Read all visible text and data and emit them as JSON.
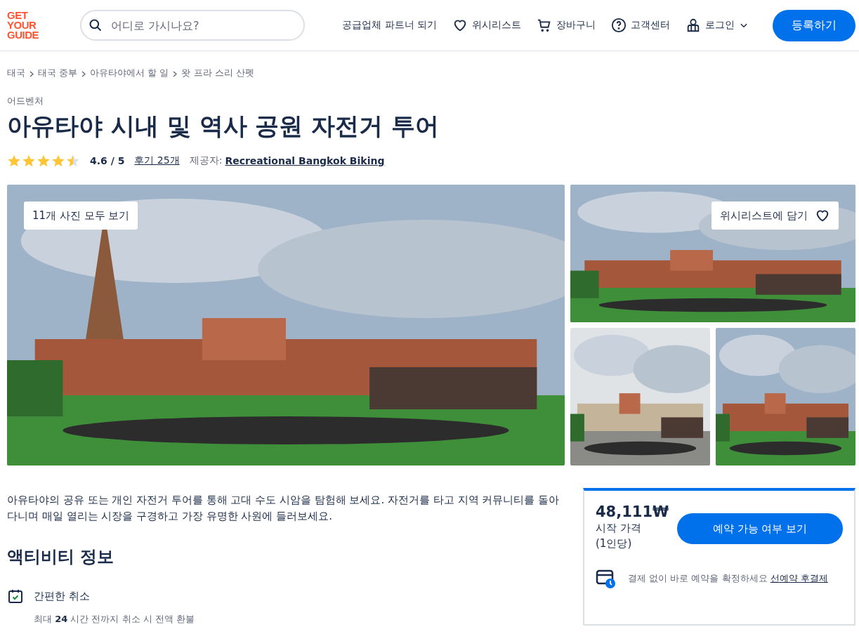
{
  "header": {
    "logo": [
      "GET",
      "YOUR",
      "GUIDE"
    ],
    "search": {
      "placeholder": "어디로 가시나요?"
    },
    "nav": [
      {
        "kind": "text",
        "label": "공급업체 파트너 되기"
      },
      {
        "kind": "heart",
        "label": "위시리스트"
      },
      {
        "kind": "cart",
        "label": "장바구니"
      },
      {
        "kind": "help",
        "label": "고객센터"
      },
      {
        "kind": "user",
        "label": "로그인"
      }
    ],
    "signup": "등록하기"
  },
  "breadcrumbs": [
    "태국",
    "태국 중부",
    "아유타야에서 할 일",
    "왓 프라 스리 산펫"
  ],
  "category": "어드벤처",
  "title": "아유타야 시내 및 역사 공원 자전거 투어",
  "rating": {
    "stars": 4.5,
    "score": "4.6 / 5",
    "reviews": "후기 25개",
    "provider_label": "제공자:",
    "provider": "Recreational Bangkok Biking"
  },
  "gallery": {
    "all_photos": "11개 사진 모두 보기",
    "wishlist": "위시리스트에 담기",
    "photos": [
      {
        "kind": "temple"
      },
      {
        "kind": "ruins"
      },
      {
        "kind": "market"
      },
      {
        "kind": "park"
      }
    ]
  },
  "description": "아유타야의 공유 또는 개인 자전거 투어를 통해 고대 수도 시암을 탐험해 보세요. 자전거를 타고 지역 커뮤니티를 돌아다니며 매일 열리는 시장을 구경하고 가장 유명한 사원에 들러보세요.",
  "info": {
    "heading": "액티비티 정보",
    "items": [
      {
        "title": "간편한 취소",
        "detail": "최대 **24** 시간 전까지 취소 시 전액 환불"
      }
    ]
  },
  "booking": {
    "price": "48,111₩",
    "from": "시작 가격",
    "per": "(1인당)",
    "button": "예약 가능 여부 보기",
    "note": "결제 없이 바로 예약을 확정하세요",
    "note_link": "선예약 후결제"
  }
}
